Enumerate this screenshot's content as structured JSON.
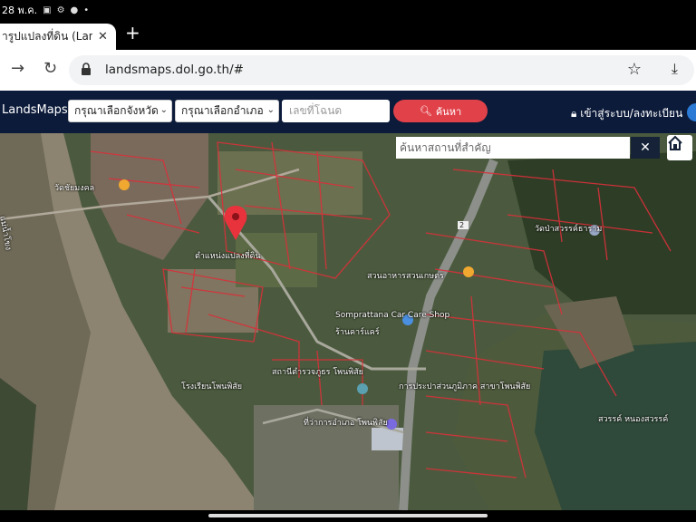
{
  "status_bar": {
    "time": "28 พ.ค."
  },
  "tab": {
    "title": "ารูปแปลงที่ดิน (Lands",
    "close": "✕"
  },
  "toolbar": {
    "new_tab": "+",
    "url": "landsmaps.dol.go.th/#"
  },
  "header": {
    "brand": "LandsMaps",
    "province_select": "กรุณาเลือกจังหวัด",
    "district_select": "กรุณาเลือกอำเภอ",
    "deed_placeholder": "เลขที่โฉนด",
    "search_button": "ค้นหา",
    "login": "เข้าสู่ระบบ/ลงทะเบียน"
  },
  "map": {
    "search_placeholder": "ค้นหาสถานที่สำคัญ",
    "close": "✕",
    "labels": {
      "pin_label": "ตำแหน่งแปลงที่ดิน",
      "temple": "วัดชัยมงคล",
      "route": "2",
      "restaurant": "สวนอาหารสวนเกษตร",
      "monastery": "วัดป่าสวรรค์ธาราม",
      "car_care": "Somprattana Car Care Shop",
      "car_care_sub": "ร้านคาร์แคร์",
      "station": "สถานีตำรวจภูธร โพนพิสัย",
      "pwa": "การประปาส่วนภูมิภาค สาขาโพนพิสัย",
      "school": "โรงเรียนโพนพิสัย",
      "office": "ที่ว่าการอำเภอ โพนพิสัย",
      "marsh": "สวรรค์ หนองสวรรค์",
      "river": "แม่น้ำโขง"
    }
  },
  "colors": {
    "header_bg": "#0c1b3a",
    "search_btn": "#e1424a",
    "parcel_line": "#d9303a",
    "pin": "#e8323c"
  }
}
